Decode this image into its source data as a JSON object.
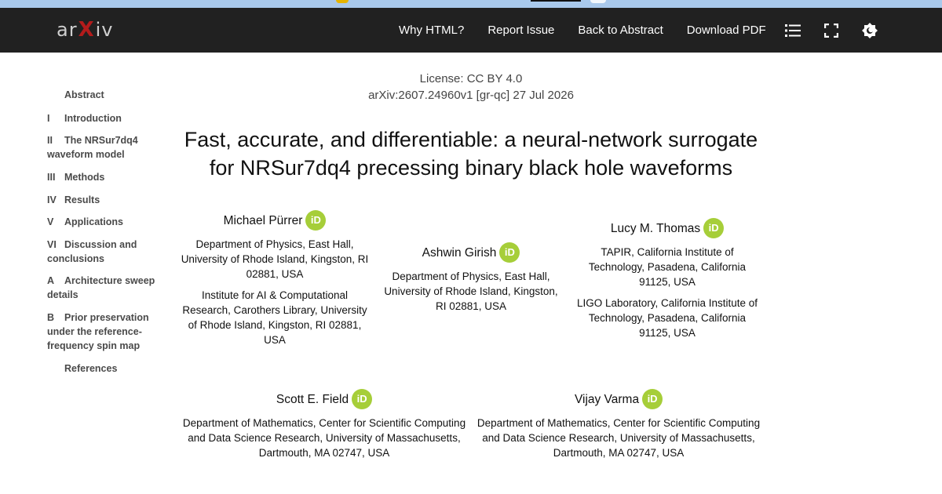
{
  "header": {
    "logo": {
      "prefix": "ar",
      "x": "X",
      "suffix": "iv"
    },
    "links": [
      "Why HTML?",
      "Report Issue",
      "Back to Abstract",
      "Download PDF"
    ],
    "icons": [
      "list-icon",
      "fullscreen-icon",
      "theme-toggle-icon"
    ]
  },
  "toc": [
    {
      "num": "",
      "label": "Abstract"
    },
    {
      "num": "I",
      "label": "Introduction"
    },
    {
      "num": "II",
      "label": "The NRSur7dq4 waveform model"
    },
    {
      "num": "III",
      "label": "Methods"
    },
    {
      "num": "IV",
      "label": "Results"
    },
    {
      "num": "V",
      "label": "Applications"
    },
    {
      "num": "VI",
      "label": "Discussion and conclusions"
    },
    {
      "num": "A",
      "label": "Architecture sweep details"
    },
    {
      "num": "B",
      "label": "Prior preservation under the reference-frequency spin map"
    },
    {
      "num": "",
      "label": "References"
    }
  ],
  "paper": {
    "license": "License: CC BY 4.0",
    "arxiv_id": "arXiv:2607.24960v1 [gr-qc] 27 Jul 2026",
    "title_line1": "Fast, accurate, and differentiable: a neural-network surrogate",
    "title_line2": "for NRSur7dq4 precessing binary black hole waveforms",
    "orcid_label": "iD",
    "authors": [
      {
        "name": "Michael Pürrer",
        "affiliations": [
          "Department of Physics, East Hall, University of Rhode Island, Kingston, RI 02881, USA",
          "Institute for AI & Computational Research, Carothers Library, University of Rhode Island, Kingston, RI 02881, USA"
        ]
      },
      {
        "name": "Ashwin Girish",
        "affiliations": [
          "Department of Physics, East Hall, University of Rhode Island, Kingston, RI 02881, USA"
        ]
      },
      {
        "name": "Lucy M. Thomas",
        "affiliations": [
          "TAPIR, California Institute of Technology, Pasadena, California 91125, USA",
          "LIGO Laboratory, California Institute of Technology, Pasadena, California 91125, USA"
        ]
      },
      {
        "name": "Scott E. Field",
        "affiliations": [
          "Department of Mathematics, Center for Scientific Computing and Data Science Research, University of Massachusetts, Dartmouth, MA 02747, USA"
        ]
      },
      {
        "name": "Vijay Varma",
        "affiliations": [
          "Department of Mathematics, Center for Scientific Computing and Data Science Research, University of Massachusetts, Dartmouth, MA 02747, USA"
        ]
      }
    ]
  },
  "colors": {
    "header_bg": "#212121",
    "logo_accent": "#b31b1b",
    "orcid": "#a6ce39"
  }
}
